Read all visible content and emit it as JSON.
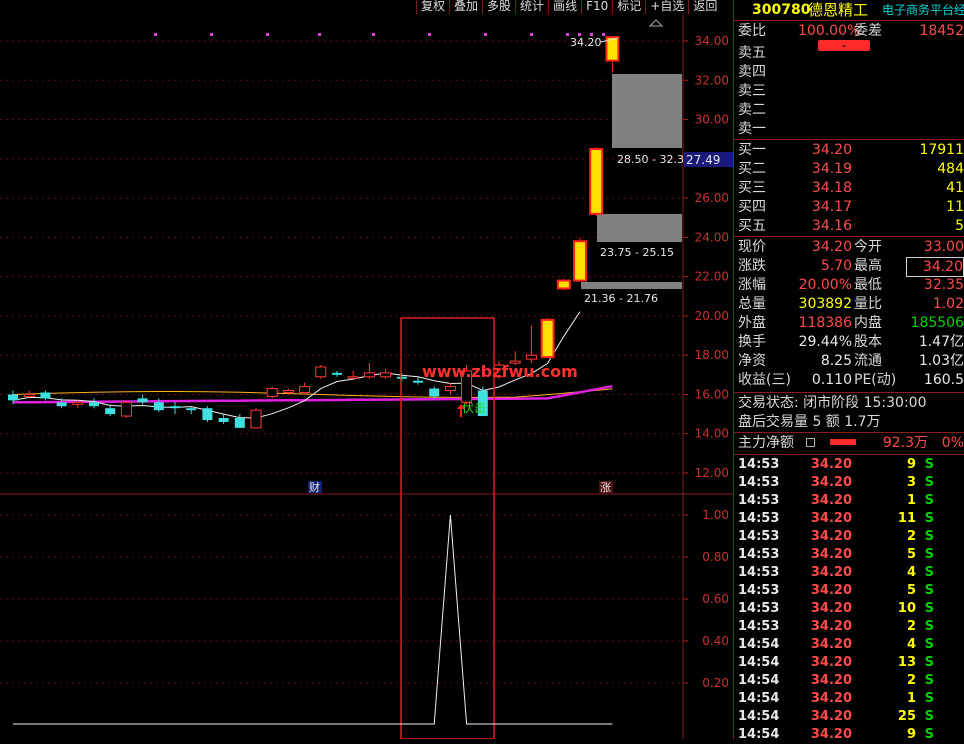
{
  "toolbar": {
    "items": [
      "复权",
      "叠加",
      "多股",
      "统计",
      "画线",
      "F10",
      "标记",
      "+自选",
      "返回"
    ]
  },
  "stock": {
    "code": "300780",
    "name": "德恩精工",
    "sector": "电子商务平台经"
  },
  "weibi": {
    "label": "委比",
    "value": "100.00%",
    "diff_label": "委差",
    "diff_value": "18452"
  },
  "sell": [
    {
      "label": "卖五"
    },
    {
      "label": "卖四"
    },
    {
      "label": "卖三"
    },
    {
      "label": "卖二"
    },
    {
      "label": "卖一"
    }
  ],
  "buy": [
    {
      "label": "买一",
      "price": "34.20",
      "vol": "17911"
    },
    {
      "label": "买二",
      "price": "34.19",
      "vol": "484"
    },
    {
      "label": "买三",
      "price": "34.18",
      "vol": "41"
    },
    {
      "label": "买四",
      "price": "34.17",
      "vol": "11"
    },
    {
      "label": "买五",
      "price": "34.16",
      "vol": "5"
    }
  ],
  "quote": [
    {
      "l1": "现价",
      "v1": "34.20",
      "l2": "今开",
      "v2": "33.00"
    },
    {
      "l1": "涨跌",
      "v1": "5.70",
      "l2": "最高",
      "v2": "34.20"
    },
    {
      "l1": "涨幅",
      "v1": "20.00%",
      "l2": "最低",
      "v2": "32.35"
    },
    {
      "l1": "总量",
      "v1": "303892",
      "l2": "量比",
      "v2": "1.02"
    },
    {
      "l1": "外盘",
      "v1": "118386",
      "l2": "内盘",
      "v2": "185506"
    },
    {
      "l1": "换手",
      "v1": "29.44%",
      "l2": "股本",
      "v2": "1.47亿"
    },
    {
      "l1": "净资",
      "v1": "8.25",
      "l2": "流通",
      "v2": "1.03亿"
    },
    {
      "l1": "收益(三)",
      "v1": "0.110",
      "l2": "PE(动)",
      "v2": "160.5"
    }
  ],
  "status": {
    "trade": "交易状态: 闭市阶段 15:30:00",
    "after": "盘后交易量 5 额 1.7万"
  },
  "netflow": {
    "label": "主力净额",
    "value": "92.3万",
    "pct": "0%"
  },
  "ticks": [
    {
      "t": "14:53",
      "p": "34.20",
      "v": "9",
      "s": "S"
    },
    {
      "t": "14:53",
      "p": "34.20",
      "v": "3",
      "s": "S"
    },
    {
      "t": "14:53",
      "p": "34.20",
      "v": "1",
      "s": "S"
    },
    {
      "t": "14:53",
      "p": "34.20",
      "v": "11",
      "s": "S"
    },
    {
      "t": "14:53",
      "p": "34.20",
      "v": "2",
      "s": "S"
    },
    {
      "t": "14:53",
      "p": "34.20",
      "v": "5",
      "s": "S"
    },
    {
      "t": "14:53",
      "p": "34.20",
      "v": "4",
      "s": "S"
    },
    {
      "t": "14:53",
      "p": "34.20",
      "v": "5",
      "s": "S"
    },
    {
      "t": "14:53",
      "p": "34.20",
      "v": "10",
      "s": "S"
    },
    {
      "t": "14:53",
      "p": "34.20",
      "v": "2",
      "s": "S"
    },
    {
      "t": "14:54",
      "p": "34.20",
      "v": "4",
      "s": "S"
    },
    {
      "t": "14:54",
      "p": "34.20",
      "v": "13",
      "s": "S"
    },
    {
      "t": "14:54",
      "p": "34.20",
      "v": "2",
      "s": "S"
    },
    {
      "t": "14:54",
      "p": "34.20",
      "v": "1",
      "s": "S"
    },
    {
      "t": "14:54",
      "p": "34.20",
      "v": "25",
      "s": "S"
    },
    {
      "t": "14:54",
      "p": "34.20",
      "v": "9",
      "s": "S"
    }
  ],
  "chart_data": {
    "type": "candlestick",
    "price_axis": {
      "ticks": [
        "34.00",
        "32.00",
        "30.00",
        "28.00",
        "26.00",
        "24.00",
        "22.00",
        "20.00",
        "18.00",
        "16.00",
        "14.00",
        "12.00"
      ],
      "range": [
        11,
        35
      ]
    },
    "indicator_axis": {
      "ticks": [
        "1.00",
        "0.80",
        "0.60",
        "0.40",
        "0.20"
      ],
      "range": [
        0,
        1.05
      ]
    },
    "current_price_tag": "27.49",
    "high_label": "34.20",
    "gap_labels": [
      "28.50 - 32.3",
      "23.75 - 25.15",
      "21.36 - 21.76"
    ],
    "signal_text": "伏击",
    "markers": [
      "财",
      "涨"
    ],
    "watermark": "www.zbzfwu.com",
    "candles": [
      {
        "o": 16.0,
        "c": 15.7,
        "h": 16.2,
        "l": 15.5
      },
      {
        "o": 15.9,
        "c": 16.0,
        "h": 16.2,
        "l": 15.8
      },
      {
        "o": 16.1,
        "c": 15.8,
        "h": 16.2,
        "l": 15.7
      },
      {
        "o": 15.6,
        "c": 15.4,
        "h": 15.8,
        "l": 15.3
      },
      {
        "o": 15.5,
        "c": 15.6,
        "h": 15.7,
        "l": 15.3
      },
      {
        "o": 15.6,
        "c": 15.4,
        "h": 15.8,
        "l": 15.3
      },
      {
        "o": 15.3,
        "c": 15.0,
        "h": 15.5,
        "l": 14.9
      },
      {
        "o": 14.9,
        "c": 15.6,
        "h": 15.7,
        "l": 14.8
      },
      {
        "o": 15.8,
        "c": 15.6,
        "h": 16.0,
        "l": 15.5
      },
      {
        "o": 15.6,
        "c": 15.2,
        "h": 15.8,
        "l": 15.1
      },
      {
        "o": 15.4,
        "c": 15.3,
        "h": 15.6,
        "l": 15.0
      },
      {
        "o": 15.3,
        "c": 15.2,
        "h": 15.4,
        "l": 15.0
      },
      {
        "o": 15.3,
        "c": 14.7,
        "h": 15.4,
        "l": 14.6
      },
      {
        "o": 14.8,
        "c": 14.6,
        "h": 15.0,
        "l": 14.5
      },
      {
        "o": 14.8,
        "c": 14.3,
        "h": 15.0,
        "l": 14.3
      },
      {
        "o": 14.3,
        "c": 15.2,
        "h": 15.3,
        "l": 14.3
      },
      {
        "o": 15.9,
        "c": 16.3,
        "h": 16.4,
        "l": 15.8
      },
      {
        "o": 16.1,
        "c": 16.2,
        "h": 16.3,
        "l": 16.0
      },
      {
        "o": 16.1,
        "c": 16.4,
        "h": 16.6,
        "l": 16.0
      },
      {
        "o": 16.9,
        "c": 17.4,
        "h": 17.5,
        "l": 16.8
      },
      {
        "o": 17.1,
        "c": 17.0,
        "h": 17.2,
        "l": 16.9
      },
      {
        "o": 16.9,
        "c": 16.9,
        "h": 17.2,
        "l": 16.8
      },
      {
        "o": 16.9,
        "c": 17.1,
        "h": 17.6,
        "l": 16.8
      },
      {
        "o": 16.9,
        "c": 17.1,
        "h": 17.3,
        "l": 16.8
      },
      {
        "o": 16.9,
        "c": 16.8,
        "h": 17.1,
        "l": 16.7
      },
      {
        "o": 16.7,
        "c": 16.6,
        "h": 16.9,
        "l": 16.5
      },
      {
        "o": 16.3,
        "c": 15.9,
        "h": 16.4,
        "l": 15.8
      },
      {
        "o": 16.2,
        "c": 16.4,
        "h": 16.6,
        "l": 16.0
      },
      {
        "o": 15.6,
        "c": 17.2,
        "h": 17.5,
        "l": 15.5
      },
      {
        "o": 16.2,
        "c": 14.9,
        "h": 16.4,
        "l": 14.9
      },
      {
        "o": 16.9,
        "c": 17.5,
        "h": 17.7,
        "l": 16.8
      },
      {
        "o": 17.6,
        "c": 17.7,
        "h": 18.2,
        "l": 17.5
      },
      {
        "o": 17.8,
        "c": 18.0,
        "h": 19.5,
        "l": 17.6
      },
      {
        "o": 17.9,
        "c": 19.8,
        "h": 19.9,
        "l": 17.9
      },
      {
        "o": 21.4,
        "c": 21.8,
        "h": 21.9,
        "l": 21.3
      },
      {
        "o": 21.8,
        "c": 23.8,
        "h": 24.0,
        "l": 21.8
      },
      {
        "o": 25.2,
        "c": 28.5,
        "h": 28.6,
        "l": 25.1
      },
      {
        "o": 33.0,
        "c": 34.2,
        "h": 34.2,
        "l": 32.4
      }
    ],
    "indicator_values": [
      0,
      0,
      0,
      0,
      0,
      0,
      0,
      0,
      0,
      0,
      0,
      0,
      0,
      0,
      0,
      0,
      0,
      0,
      0,
      0,
      0,
      0,
      0,
      0,
      0,
      0,
      0,
      1,
      0,
      0,
      0,
      0,
      0,
      0,
      0,
      0,
      0,
      0
    ]
  }
}
